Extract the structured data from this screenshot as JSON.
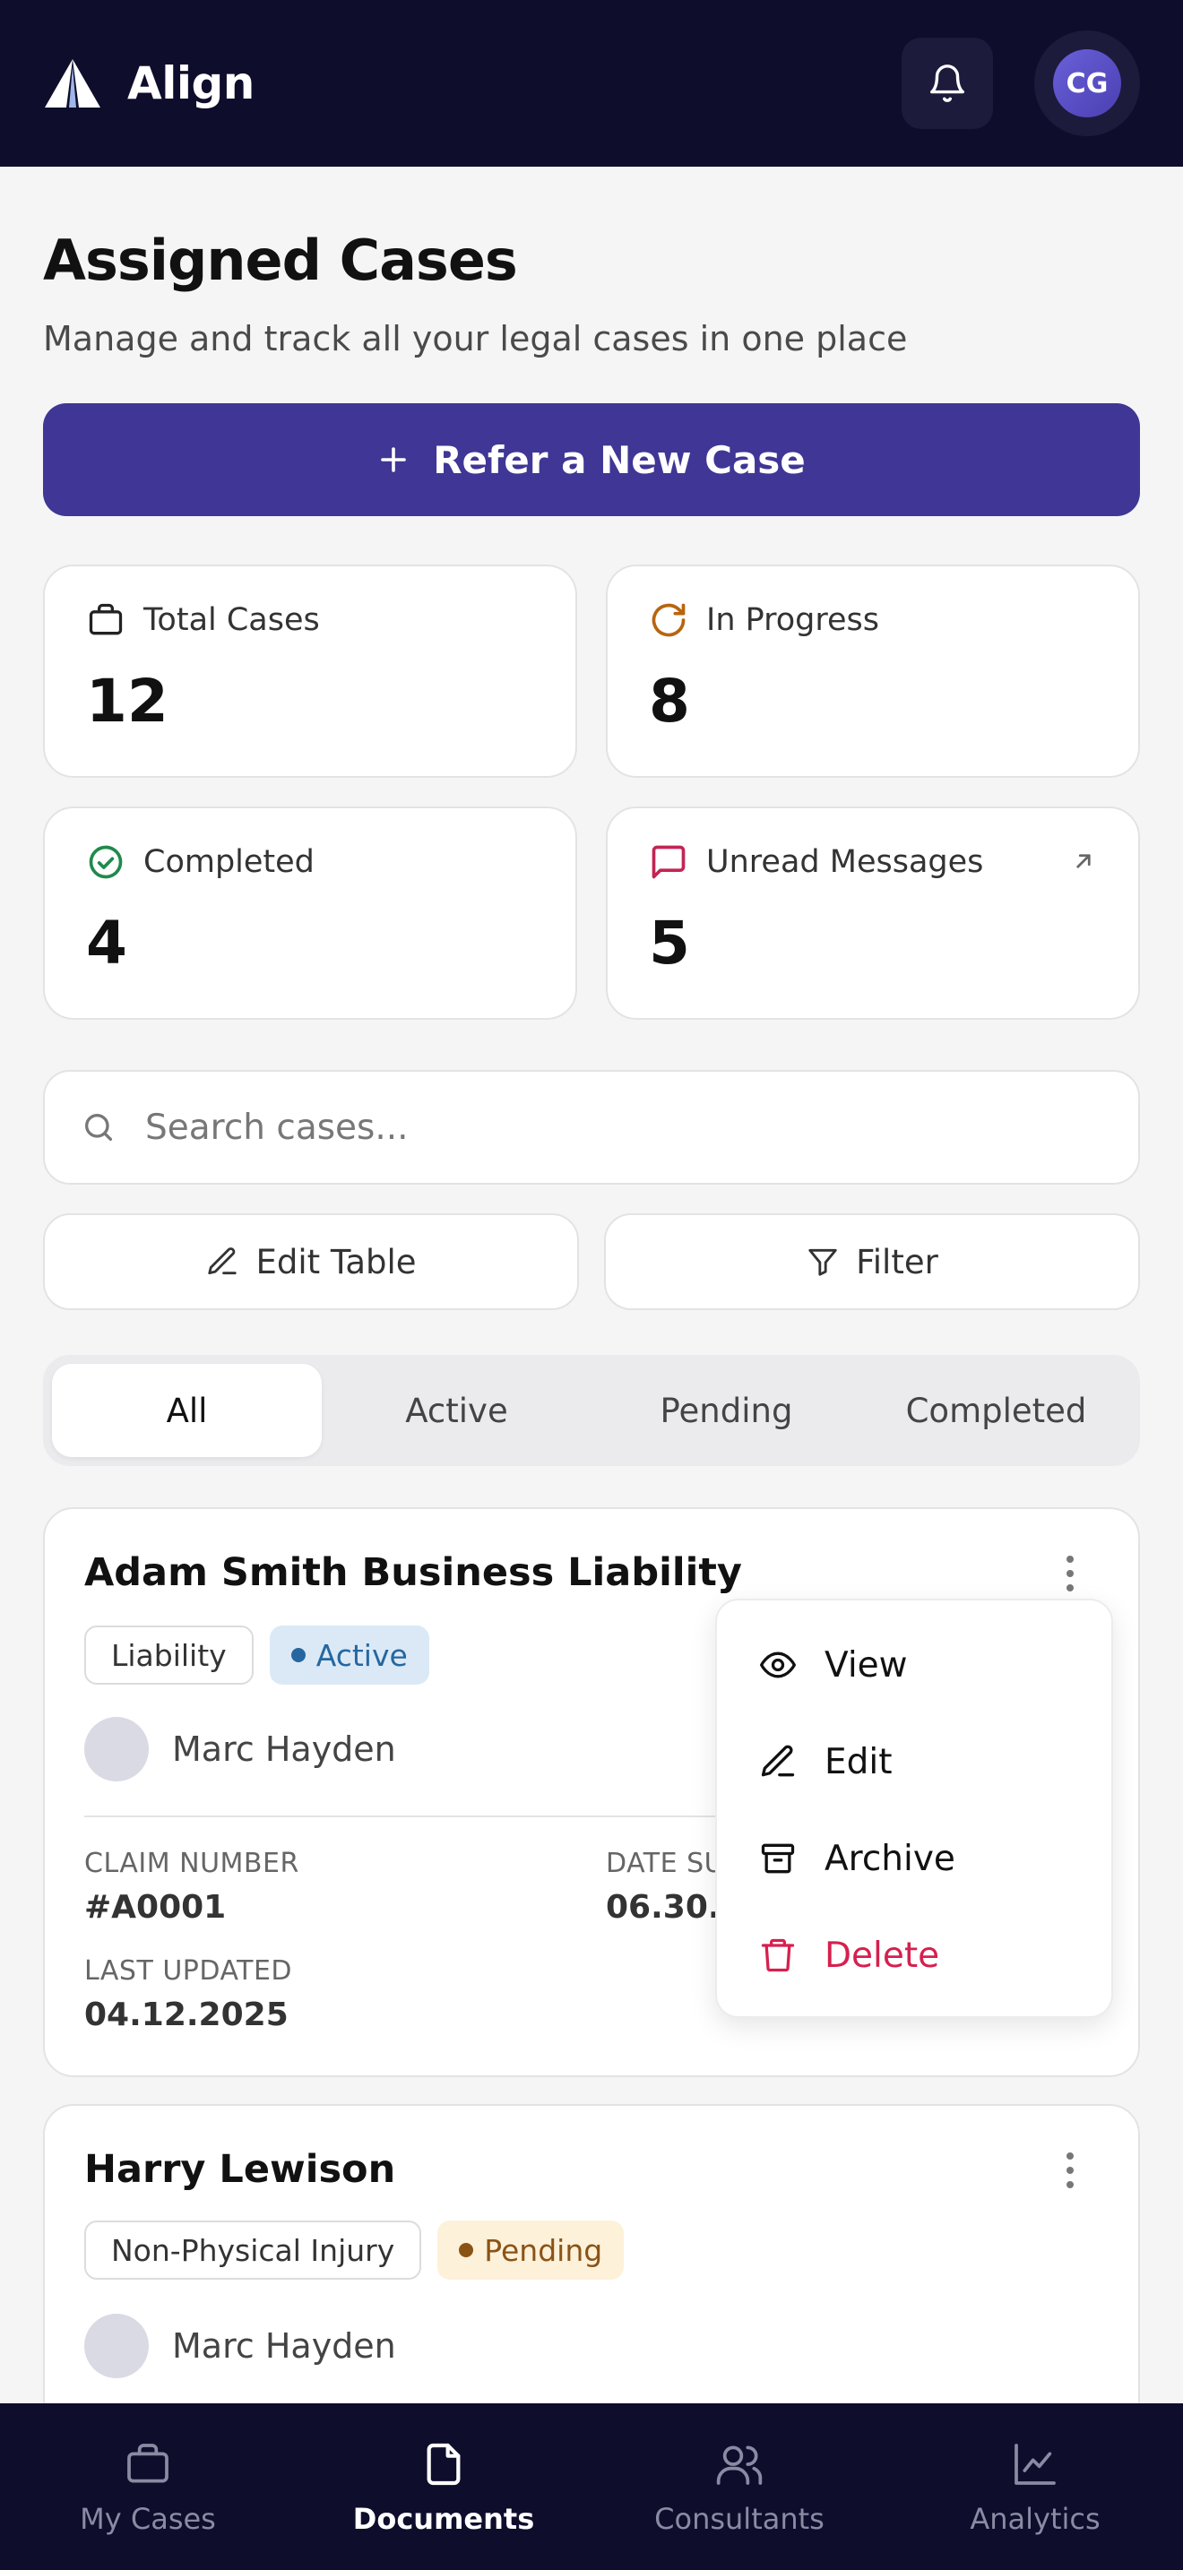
{
  "header": {
    "brand": "Align",
    "avatar_initials": "CG"
  },
  "page": {
    "title": "Assigned Cases",
    "subtitle": "Manage and track all your legal cases in one place"
  },
  "cta": {
    "label": "Refer a New Case"
  },
  "stats": [
    {
      "label": "Total Cases",
      "value": "12",
      "icon": "briefcase-icon"
    },
    {
      "label": "In Progress",
      "value": "8",
      "icon": "refresh-icon"
    },
    {
      "label": "Completed",
      "value": "4",
      "icon": "check-circle-icon"
    },
    {
      "label": "Unread Messages",
      "value": "5",
      "icon": "message-icon"
    }
  ],
  "search": {
    "placeholder": "Search cases..."
  },
  "actions": {
    "edit_table": "Edit Table",
    "filter": "Filter"
  },
  "tabs": [
    "All",
    "Active",
    "Pending",
    "Completed"
  ],
  "cases": [
    {
      "title": "Adam Smith Business Liability",
      "type": "Liability",
      "status": "Active",
      "consultant": "Marc Hayden",
      "claim_label": "CLAIM NUMBER",
      "claim_value": "#A0001",
      "date_label": "DATE SU",
      "date_value": "06.30.2",
      "updated_label": "LAST UPDATED",
      "updated_value": "04.12.2025"
    },
    {
      "title": "Harry Lewison",
      "type": "Non-Physical Injury",
      "status": "Pending",
      "consultant": "Marc Hayden"
    }
  ],
  "menu": {
    "view": "View",
    "edit": "Edit",
    "archive": "Archive",
    "delete": "Delete"
  },
  "nav": [
    "My Cases",
    "Documents",
    "Consultants",
    "Analytics"
  ],
  "colors": {
    "brand_dark": "#0e0d2c",
    "primary": "#3f3696",
    "danger": "#d6204f",
    "active_badge": "#26679f",
    "pending_badge": "#8a5316",
    "completed_green": "#1f8a4c",
    "progress_orange": "#b8650f"
  }
}
